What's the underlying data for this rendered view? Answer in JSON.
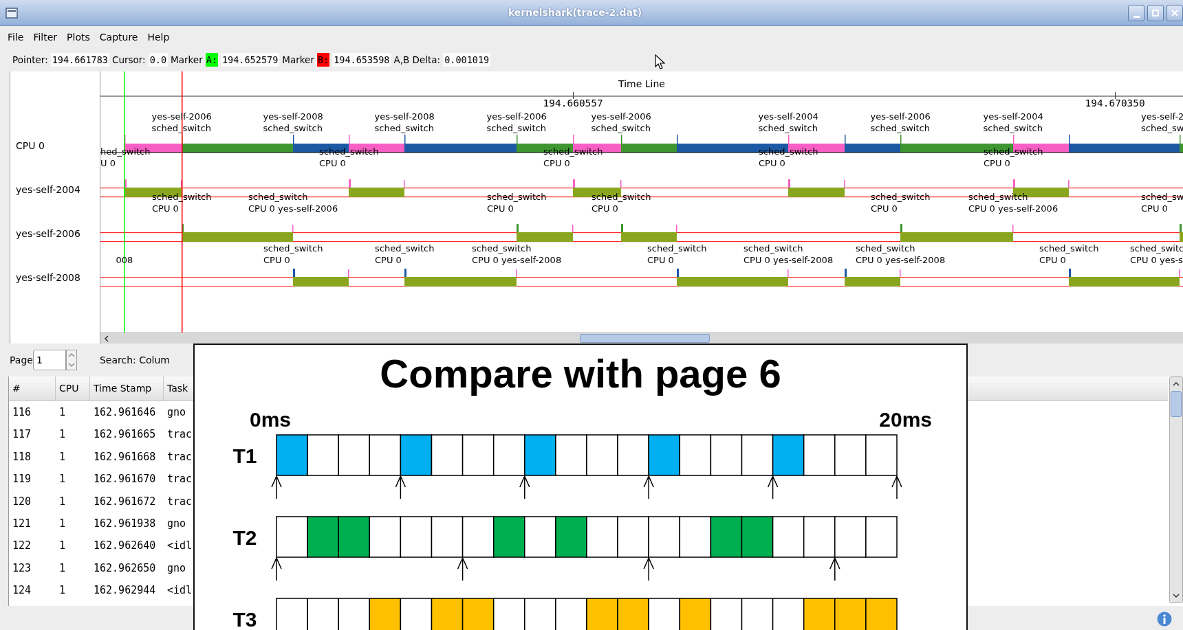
{
  "window": {
    "title": "kernelshark(trace-2.dat)"
  },
  "menu": [
    "File",
    "Filter",
    "Plots",
    "Capture",
    "Help"
  ],
  "info_bar": [
    {
      "kind": "label",
      "text": "Pointer:"
    },
    {
      "kind": "value",
      "text": "194.661783"
    },
    {
      "kind": "label",
      "text": "Cursor:"
    },
    {
      "kind": "value",
      "text": "0.0"
    },
    {
      "kind": "label",
      "text": "Marker"
    },
    {
      "kind": "tag",
      "text": "A:",
      "color": "#00ff00"
    },
    {
      "kind": "value",
      "text": "194.652579"
    },
    {
      "kind": "label",
      "text": "Marker"
    },
    {
      "kind": "tag",
      "text": "B:",
      "color": "#ff0000"
    },
    {
      "kind": "value",
      "text": "194.653598"
    },
    {
      "kind": "label",
      "text": "A,B Delta:"
    },
    {
      "kind": "value",
      "text": "0.001019"
    }
  ],
  "graph": {
    "header": "Time Line",
    "time_labels": [
      "194.660557",
      "194.670350"
    ],
    "rows": [
      {
        "label": "CPU 0",
        "kind": "cpu",
        "segments": [
          {
            "color": "#f75fc4"
          },
          {
            "color": "#3d962f"
          },
          {
            "color": "#1c58a3"
          },
          {
            "color": "#f75fc4"
          },
          {
            "color": "#1c58a3"
          },
          {
            "color": "#3d962f"
          },
          {
            "color": "#f75fc4"
          },
          {
            "color": "#3d962f"
          },
          {
            "color": "#1c58a3"
          },
          {
            "color": "#f75fc4"
          },
          {
            "color": "#1c58a3"
          },
          {
            "color": "#3d962f"
          },
          {
            "color": "#f75fc4"
          },
          {
            "color": "#1c58a3"
          },
          {
            "color": "#3d962f"
          }
        ],
        "annotations": [
          {
            "lines": [
              "yes-self-2006",
              "sched_switch"
            ]
          },
          {
            "lines": [
              "yes-self-2008",
              "sched_switch"
            ]
          },
          {
            "lines": [
              "yes-self-2008",
              "sched_switch"
            ]
          },
          {
            "lines": [
              "yes-self-2006",
              "sched_switch"
            ]
          },
          {
            "lines": [
              "yes-self-2006",
              "sched_switch"
            ]
          },
          {
            "lines": [
              "yes-self-2004",
              "sched_switch"
            ]
          },
          {
            "lines": [
              "yes-self-2006",
              "sched_switch"
            ]
          },
          {
            "lines": [
              "yes-self-2004",
              "sched_switch"
            ]
          },
          {
            "lines": [
              "yes-self-2",
              "sched_sw"
            ]
          }
        ]
      },
      {
        "label": "yes-self-2004",
        "kind": "task",
        "color": "#f75fc4",
        "annotations": [
          {
            "lines": [
              "hed_switch",
              "U 0"
            ]
          },
          {
            "lines": [
              "sched_switch",
              "CPU 0"
            ]
          },
          {
            "lines": [
              "sched_switch",
              "CPU 0"
            ]
          },
          {
            "lines": [
              "sched_switch",
              "CPU 0"
            ]
          },
          {
            "lines": [
              "sched_switch",
              "CPU 0"
            ]
          }
        ]
      },
      {
        "label": "yes-self-2006",
        "kind": "task",
        "color": "#3d962f",
        "annotations": [
          {
            "lines": [
              "sched_switch",
              "CPU 0"
            ]
          },
          {
            "lines": [
              "sched_switch",
              "CPU 0 yes-self-2006"
            ]
          },
          {
            "lines": [
              "sched_switch",
              "CPU 0"
            ]
          },
          {
            "lines": [
              "sched_switch",
              "CPU 0"
            ]
          },
          {
            "lines": [
              "sched_switch",
              "CPU 0"
            ]
          },
          {
            "lines": [
              "sched_switch",
              "CPU 0 yes-self-2006"
            ]
          },
          {
            "lines": [
              "sched_sw",
              "CPU 0"
            ]
          }
        ]
      },
      {
        "label": "yes-self-2008",
        "kind": "task",
        "color": "#1c58a3",
        "annotations": [
          {
            "lines": [
              "008"
            ]
          },
          {
            "lines": [
              "sched_switch",
              "CPU 0"
            ]
          },
          {
            "lines": [
              "sched_switch",
              "CPU 0"
            ]
          },
          {
            "lines": [
              "sched_switch",
              "CPU 0 yes-self-2008"
            ]
          },
          {
            "lines": [
              "sched_switch",
              "CPU 0"
            ]
          },
          {
            "lines": [
              "sched_switch",
              "CPU 0 yes-self-2008"
            ]
          },
          {
            "lines": [
              "sched_switch",
              "CPU 0 yes-self-2008"
            ]
          },
          {
            "lines": [
              "sched_switch",
              "CPU 0"
            ]
          },
          {
            "lines": [
              "sched_switc",
              "CPU 0 yes-s"
            ]
          }
        ]
      }
    ]
  },
  "page": {
    "label": "Page",
    "value": "1",
    "search_label": "Search: Colum"
  },
  "table": {
    "columns": [
      "#",
      "CPU",
      "Time Stamp",
      "Task"
    ],
    "rows": [
      [
        "116",
        "1",
        "162.961646",
        "gno"
      ],
      [
        "117",
        "1",
        "162.961665",
        "trac"
      ],
      [
        "118",
        "1",
        "162.961668",
        "trac"
      ],
      [
        "119",
        "1",
        "162.961670",
        "trac"
      ],
      [
        "120",
        "1",
        "162.961672",
        "trac"
      ],
      [
        "121",
        "1",
        "162.961938",
        "gno"
      ],
      [
        "122",
        "1",
        "162.962640",
        "<idl"
      ],
      [
        "123",
        "1",
        "162.962650",
        "gno"
      ],
      [
        "124",
        "1",
        "162.962944",
        "<idl"
      ]
    ]
  },
  "slide": {
    "title": "Compare with page 6",
    "start_label": "0ms",
    "end_label": "20ms",
    "tasks": [
      {
        "label": "T1",
        "color": "#00b0f0",
        "end_arrow": true,
        "cells": [
          {
            "filled": true,
            "arrow": true
          },
          {
            "filled": false,
            "arrow": false
          },
          {
            "filled": false,
            "arrow": false
          },
          {
            "filled": false,
            "arrow": false
          },
          {
            "filled": true,
            "arrow": true
          },
          {
            "filled": false,
            "arrow": false
          },
          {
            "filled": false,
            "arrow": false
          },
          {
            "filled": false,
            "arrow": false
          },
          {
            "filled": true,
            "arrow": true
          },
          {
            "filled": false,
            "arrow": false
          },
          {
            "filled": false,
            "arrow": false
          },
          {
            "filled": false,
            "arrow": false
          },
          {
            "filled": true,
            "arrow": true
          },
          {
            "filled": false,
            "arrow": false
          },
          {
            "filled": false,
            "arrow": false
          },
          {
            "filled": false,
            "arrow": false
          },
          {
            "filled": true,
            "arrow": true
          },
          {
            "filled": false,
            "arrow": false
          },
          {
            "filled": false,
            "arrow": false
          },
          {
            "filled": false,
            "arrow": false
          }
        ]
      },
      {
        "label": "T2",
        "color": "#00b050",
        "end_arrow": false,
        "cells": [
          {
            "filled": false,
            "arrow": true
          },
          {
            "filled": true,
            "arrow": false
          },
          {
            "filled": true,
            "arrow": false
          },
          {
            "filled": false,
            "arrow": false
          },
          {
            "filled": false,
            "arrow": false
          },
          {
            "filled": false,
            "arrow": false
          },
          {
            "filled": false,
            "arrow": true
          },
          {
            "filled": true,
            "arrow": false
          },
          {
            "filled": false,
            "arrow": false
          },
          {
            "filled": true,
            "arrow": false
          },
          {
            "filled": false,
            "arrow": false
          },
          {
            "filled": false,
            "arrow": false
          },
          {
            "filled": false,
            "arrow": true
          },
          {
            "filled": false,
            "arrow": false
          },
          {
            "filled": true,
            "arrow": false
          },
          {
            "filled": true,
            "arrow": false
          },
          {
            "filled": false,
            "arrow": false
          },
          {
            "filled": false,
            "arrow": false
          },
          {
            "filled": false,
            "arrow": true
          },
          {
            "filled": false,
            "arrow": false
          }
        ]
      },
      {
        "label": "T3",
        "color": "#ffc000",
        "end_arrow": false,
        "cells": [
          {
            "filled": false,
            "arrow": false
          },
          {
            "filled": false,
            "arrow": false
          },
          {
            "filled": false,
            "arrow": false
          },
          {
            "filled": true,
            "arrow": false
          },
          {
            "filled": false,
            "arrow": false
          },
          {
            "filled": true,
            "arrow": false
          },
          {
            "filled": true,
            "arrow": false
          },
          {
            "filled": false,
            "arrow": false
          },
          {
            "filled": false,
            "arrow": false
          },
          {
            "filled": false,
            "arrow": false
          },
          {
            "filled": true,
            "arrow": false
          },
          {
            "filled": true,
            "arrow": false
          },
          {
            "filled": false,
            "arrow": false
          },
          {
            "filled": true,
            "arrow": false
          },
          {
            "filled": false,
            "arrow": false
          },
          {
            "filled": false,
            "arrow": false
          },
          {
            "filled": false,
            "arrow": false
          },
          {
            "filled": true,
            "arrow": false
          },
          {
            "filled": true,
            "arrow": false
          },
          {
            "filled": true,
            "arrow": false
          }
        ]
      }
    ]
  }
}
